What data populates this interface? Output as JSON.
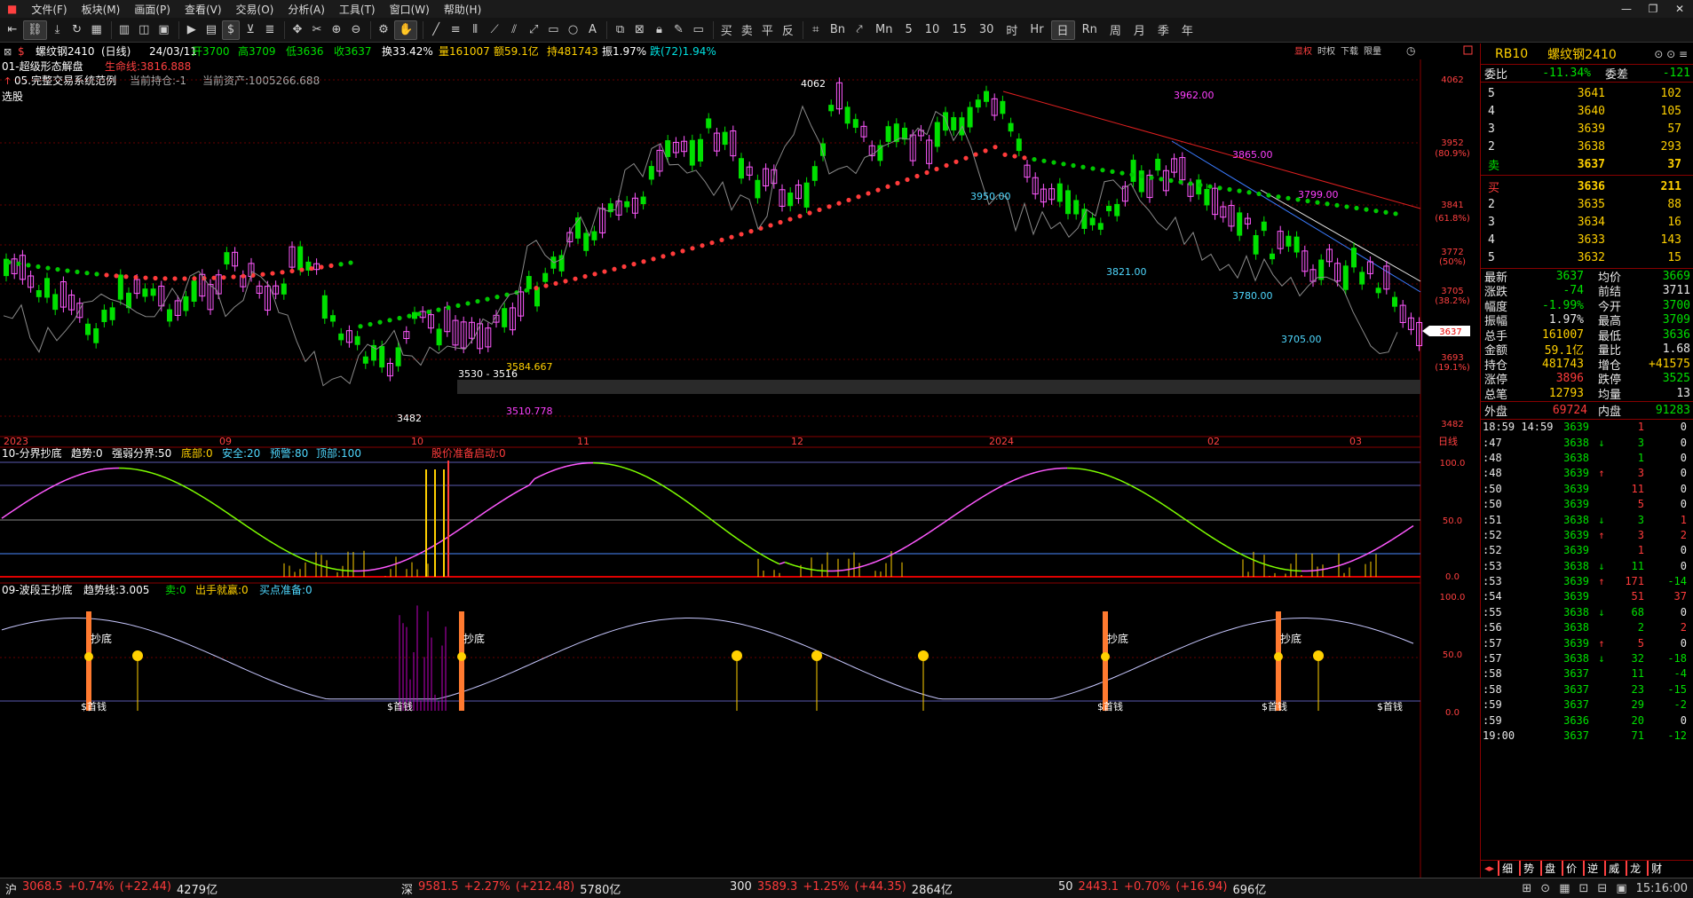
{
  "menu": {
    "items": [
      "文件(F)",
      "板块(M)",
      "画面(P)",
      "查看(V)",
      "交易(O)",
      "分析(A)",
      "工具(T)",
      "窗口(W)",
      "帮助(H)"
    ],
    "window_buttons": [
      "—",
      "❐",
      "✕"
    ]
  },
  "toolbar": {
    "periods": [
      "Mn",
      "5",
      "10",
      "15",
      "30",
      "时",
      "Hr",
      "日",
      "Rn",
      "周",
      "月",
      "季",
      "年"
    ],
    "active_period": "日",
    "trade_buttons": [
      "买",
      "卖",
      "平",
      "反"
    ],
    "bn_label": "Bn"
  },
  "header": {
    "symbol": "螺纹钢2410",
    "period": "(日线)",
    "date": "24/03/11",
    "open": "开3700",
    "high": "高3709",
    "low": "低3636",
    "close": "收3637",
    "turnover": "换33.42%",
    "volume": "量161007",
    "amount": "额59.1亿",
    "oi": "持481743",
    "amplitude": "振1.97%",
    "change": "跌(72)1.94%",
    "study1": "01-超级形态解盘",
    "lifeline": "生命线:3816.888",
    "study2": "05.完整交易系统范例",
    "position": "当前持仓:-1",
    "assets": "当前资产:1005266.688",
    "select": "选股",
    "top_right_tabs": [
      "显权",
      "时权",
      "下载",
      "限量"
    ]
  },
  "price_axis": [
    "4062",
    "3952",
    "(80.9%)",
    "3841",
    "(61.8%)",
    "3772",
    "(50%)",
    "3705",
    "(38.2%)",
    "3693",
    "(19.1%)",
    "3482"
  ],
  "current_price_tag": "3637",
  "annotations": {
    "peak": "4062",
    "trough": "3482",
    "level1": "3962.00",
    "level2": "3865.00",
    "level3": "3799.00",
    "level4": "3950.00",
    "level5": "3821.00",
    "level6": "3780.00",
    "level7": "3705.00",
    "fib1": "3584.667",
    "fib2": "3530 - 3516",
    "fib3": "3510.778"
  },
  "time_axis": [
    "2023",
    "09",
    "10",
    "11",
    "12",
    "2024",
    "02",
    "03",
    "日线"
  ],
  "sub1": {
    "title": "10-分界抄底",
    "trend": "趋势:0",
    "boundary": "强弱分界:50",
    "bottom": "底部:0",
    "safe": "安全:20",
    "warn": "预警:80",
    "top": "顶部:100",
    "launch": "股价准备启动:0",
    "axis": [
      "100.0",
      "50.0",
      "0.0"
    ]
  },
  "sub2": {
    "title": "09-波段王抄底",
    "trendline": "趋势线:3.005",
    "sell": "卖:0",
    "win": "出手就赢:0",
    "buyprep": "买点准备:0",
    "axis": [
      "100.0",
      "50.0",
      "0.0"
    ],
    "label_bottom": "抄底",
    "label_money": "$首钱"
  },
  "quote": {
    "code": "RB10",
    "name": "螺纹钢2410",
    "weibi_label": "委比",
    "weibi": "-11.34%",
    "weicha_label": "委差",
    "weicha": "-121",
    "asks": [
      {
        "level": "5",
        "price": "3641",
        "vol": "102"
      },
      {
        "level": "4",
        "price": "3640",
        "vol": "105"
      },
      {
        "level": "3",
        "price": "3639",
        "vol": "57"
      },
      {
        "level": "2",
        "price": "3638",
        "vol": "293"
      },
      {
        "level": "卖",
        "price": "3637",
        "vol": "37"
      }
    ],
    "bids": [
      {
        "level": "买",
        "price": "3636",
        "vol": "211"
      },
      {
        "level": "2",
        "price": "3635",
        "vol": "88"
      },
      {
        "level": "3",
        "price": "3634",
        "vol": "16"
      },
      {
        "level": "4",
        "price": "3633",
        "vol": "143"
      },
      {
        "level": "5",
        "price": "3632",
        "vol": "15"
      }
    ],
    "stats": [
      {
        "k1": "最新",
        "v1": "3637",
        "c1": "green",
        "k2": "均价",
        "v2": "3669",
        "c2": "green"
      },
      {
        "k1": "涨跌",
        "v1": "-74",
        "c1": "green",
        "k2": "前结",
        "v2": "3711",
        "c2": "white"
      },
      {
        "k1": "幅度",
        "v1": "-1.99%",
        "c1": "green",
        "k2": "今开",
        "v2": "3700",
        "c2": "green"
      },
      {
        "k1": "振幅",
        "v1": "1.97%",
        "c1": "white",
        "k2": "最高",
        "v2": "3709",
        "c2": "green"
      },
      {
        "k1": "总手",
        "v1": "161007",
        "c1": "yellow",
        "k2": "最低",
        "v2": "3636",
        "c2": "green"
      },
      {
        "k1": "金额",
        "v1": "59.1亿",
        "c1": "yellow",
        "k2": "量比",
        "v2": "1.68",
        "c2": "white"
      },
      {
        "k1": "持仓",
        "v1": "481743",
        "c1": "yellow",
        "k2": "增仓",
        "v2": "+41575",
        "c2": "yellow"
      },
      {
        "k1": "涨停",
        "v1": "3896",
        "c1": "red",
        "k2": "跌停",
        "v2": "3525",
        "c2": "green"
      },
      {
        "k1": "总笔",
        "v1": "12793",
        "c1": "yellow",
        "k2": "均量",
        "v2": "13",
        "c2": "white"
      }
    ],
    "outer_label": "外盘",
    "outer": "69724",
    "inner_label": "内盘",
    "inner": "91283",
    "ticks": [
      {
        "t": "18:59 14:59",
        "p": "3639",
        "d": "",
        "v": "1",
        "o": "0",
        "vc": "red"
      },
      {
        "t": ":47",
        "p": "3638",
        "d": "↓",
        "v": "3",
        "o": "0",
        "vc": "green"
      },
      {
        "t": ":48",
        "p": "3638",
        "d": "",
        "v": "1",
        "o": "0",
        "vc": "green"
      },
      {
        "t": ":48",
        "p": "3639",
        "d": "↑",
        "v": "3",
        "o": "0",
        "vc": "red"
      },
      {
        "t": ":50",
        "p": "3639",
        "d": "",
        "v": "11",
        "o": "0",
        "vc": "red"
      },
      {
        "t": ":50",
        "p": "3639",
        "d": "",
        "v": "5",
        "o": "0",
        "vc": "red"
      },
      {
        "t": ":51",
        "p": "3638",
        "d": "↓",
        "v": "3",
        "o": "1",
        "vc": "green"
      },
      {
        "t": ":52",
        "p": "3639",
        "d": "↑",
        "v": "3",
        "o": "2",
        "vc": "red"
      },
      {
        "t": ":52",
        "p": "3639",
        "d": "",
        "v": "1",
        "o": "0",
        "vc": "red"
      },
      {
        "t": ":53",
        "p": "3638",
        "d": "↓",
        "v": "11",
        "o": "0",
        "vc": "green"
      },
      {
        "t": ":53",
        "p": "3639",
        "d": "↑",
        "v": "171",
        "o": "-14",
        "vc": "red"
      },
      {
        "t": ":54",
        "p": "3639",
        "d": "",
        "v": "51",
        "o": "37",
        "vc": "red"
      },
      {
        "t": ":55",
        "p": "3638",
        "d": "↓",
        "v": "68",
        "o": "0",
        "vc": "green"
      },
      {
        "t": ":56",
        "p": "3638",
        "d": "",
        "v": "2",
        "o": "2",
        "vc": "green"
      },
      {
        "t": ":57",
        "p": "3639",
        "d": "↑",
        "v": "5",
        "o": "0",
        "vc": "red"
      },
      {
        "t": ":57",
        "p": "3638",
        "d": "↓",
        "v": "32",
        "o": "-18",
        "vc": "green"
      },
      {
        "t": ":58",
        "p": "3637",
        "d": "",
        "v": "11",
        "o": "-4",
        "vc": "green"
      },
      {
        "t": ":58",
        "p": "3637",
        "d": "",
        "v": "23",
        "o": "-15",
        "vc": "green"
      },
      {
        "t": ":59",
        "p": "3637",
        "d": "",
        "v": "29",
        "o": "-2",
        "vc": "green"
      },
      {
        "t": ":59",
        "p": "3636",
        "d": "",
        "v": "20",
        "o": "0",
        "vc": "green"
      },
      {
        "t": "19:00",
        "p": "3637",
        "d": "",
        "v": "71",
        "o": "-12",
        "vc": "green"
      }
    ],
    "bottom_tabs": [
      "细",
      "势",
      "盘",
      "价",
      "逆",
      "威",
      "龙",
      "财"
    ]
  },
  "status": {
    "items": [
      {
        "name": "沪",
        "val": "3068.5",
        "chg": "+0.74%",
        "d": "(+22.44)",
        "amt": "4279亿"
      },
      {
        "name": "深",
        "val": "9581.5",
        "chg": "+2.27%",
        "d": "(+212.48)",
        "amt": "5780亿"
      },
      {
        "name": "300",
        "val": "3589.3",
        "chg": "+1.25%",
        "d": "(+44.35)",
        "amt": "2864亿"
      },
      {
        "name": "50",
        "val": "2443.1",
        "chg": "+0.70%",
        "d": "(+16.94)",
        "amt": "696亿"
      }
    ],
    "clock": "15:16:00"
  },
  "colors": {
    "up": "#ff3b3b",
    "down": "#00e000",
    "candle_up": "#ff59ff",
    "lifeline_up": "#ff3b3b",
    "lifeline_down": "#00c800",
    "grid": "#800000"
  }
}
